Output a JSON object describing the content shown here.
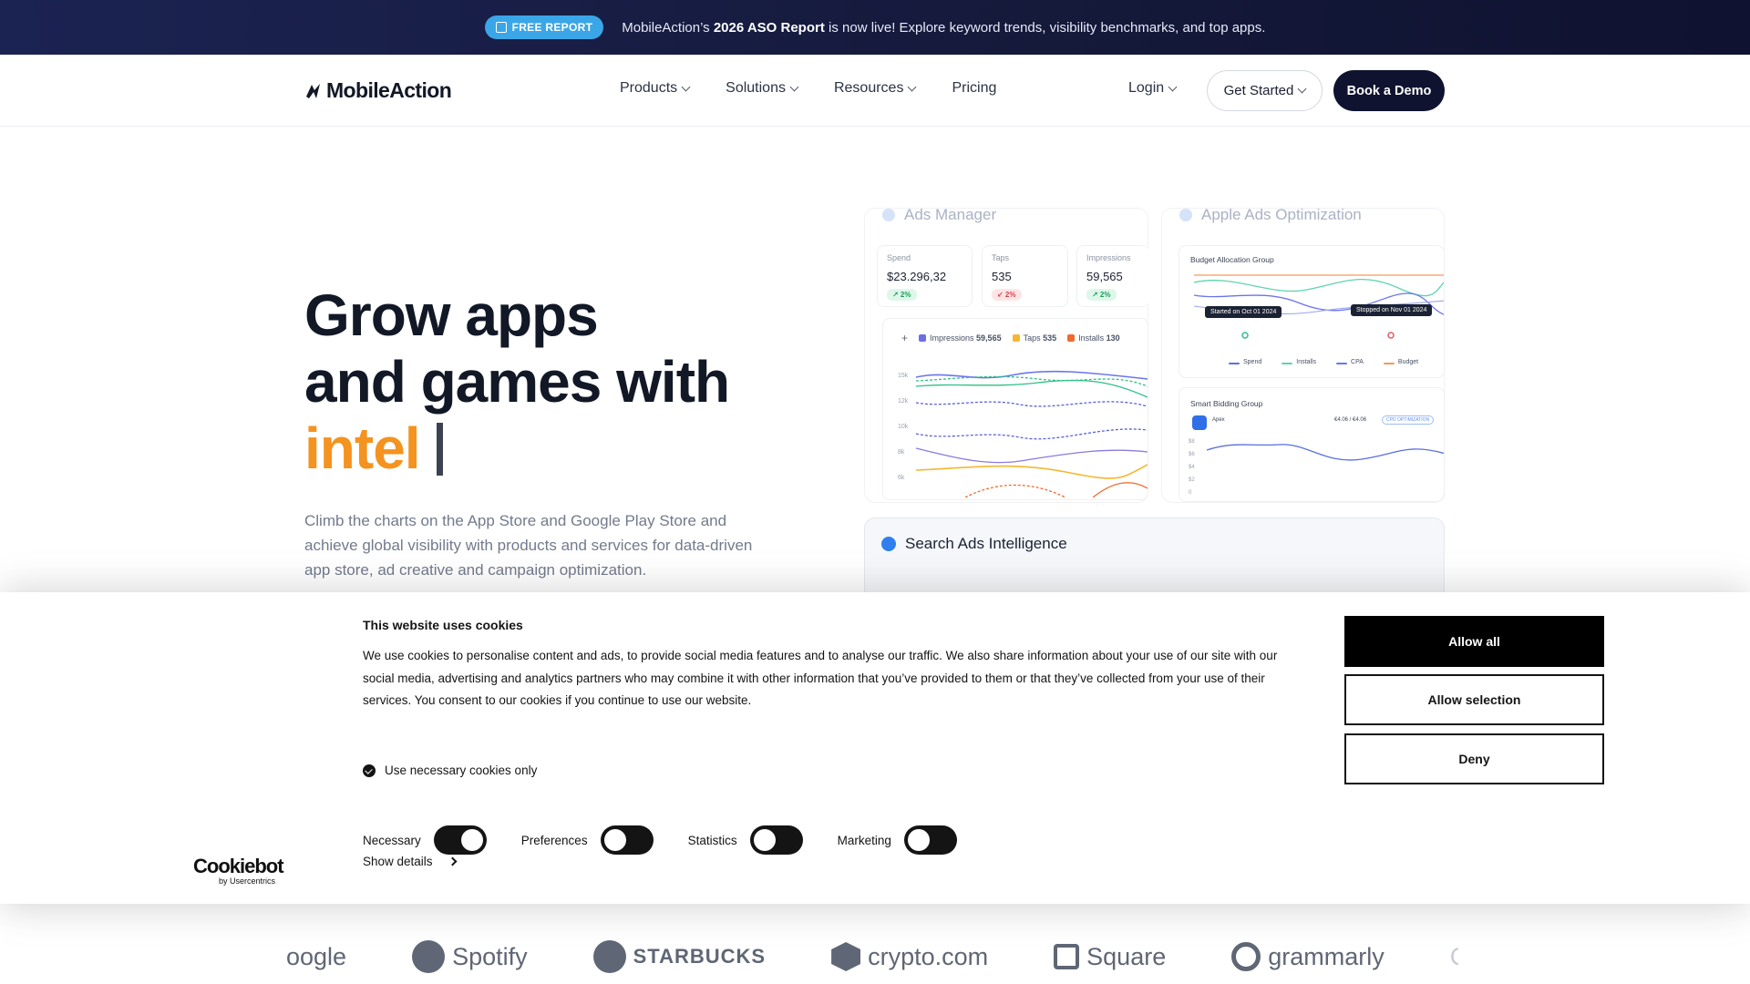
{
  "announcement": {
    "badge": "FREE REPORT",
    "text_prefix": "MobileAction’s ",
    "text_bold": "2026 ASO Report",
    "text_suffix": " is now live! Explore keyword trends, visibility benchmarks, and top apps."
  },
  "nav": {
    "logo": "MobileAction",
    "links": [
      "Products",
      "Solutions",
      "Resources",
      "Pricing"
    ],
    "login": "Login",
    "get_started": "Get Started",
    "book_demo": "Book a Demo"
  },
  "hero": {
    "title_line1": "Grow apps",
    "title_line2": "and games with",
    "title_accent": "intel",
    "description": "Climb the charts on the App Store and Google Play Store and achieve global visibility with products and services for data-driven app store, ad creative and campaign optimization."
  },
  "dashboard": {
    "ads_manager": {
      "title": "Ads Manager",
      "stats": [
        {
          "label": "Spend",
          "value": "$23.296,32",
          "change": "↗ 2%",
          "dir": "up"
        },
        {
          "label": "Taps",
          "value": "535",
          "change": "↙ 2%",
          "dir": "down"
        },
        {
          "label": "Impressions",
          "value": "59,565",
          "change": "↗ 2%",
          "dir": "up"
        }
      ],
      "legend": [
        {
          "name": "Impressions",
          "value": "59,565",
          "color": "#6b6ee8"
        },
        {
          "name": "Taps",
          "value": "535",
          "color": "#f5b731"
        },
        {
          "name": "Installs",
          "value": "130",
          "color": "#ee6a2f"
        }
      ],
      "y_ticks": [
        "15k",
        "12k",
        "10k",
        "8k",
        "6k"
      ]
    },
    "apple_ads": {
      "title": "Apple Ads Optimization",
      "budget_group": "Budget Allocation Group",
      "tooltip_start": "Started on Oct 01 2024",
      "tooltip_stop": "Stopped on Nov 01 2024",
      "legend": [
        {
          "name": "Spend",
          "color": "#5b6ee8"
        },
        {
          "name": "Installs",
          "color": "#5fd3b0"
        },
        {
          "name": "CPA",
          "color": "#6a74f0"
        },
        {
          "name": "Budget",
          "color": "#f29a5a"
        }
      ],
      "smart_group": "Smart Bidding Group",
      "app_name": "Apex",
      "bid": "€4.06 / €4.06",
      "tag": "CPD OPTIMIZATION",
      "y_ticks": [
        "$8",
        "$6",
        "$4",
        "$2",
        "0"
      ]
    },
    "search_ads": {
      "title": "Search Ads Intelligence"
    }
  },
  "cookie": {
    "title": "This website uses cookies",
    "body": "We use cookies to personalise content and ads, to provide social media features and to analyse our traffic. We also share information about your use of our site with our social media, advertising and analytics partners who may combine it with other information that you’ve provided to them or that they’ve collected from your use of their services. You consent to our cookies if you continue to use our website.",
    "check_label": "Use necessary cookies only",
    "toggles": [
      {
        "label": "Necessary",
        "state": "on"
      },
      {
        "label": "Preferences",
        "state": "off"
      },
      {
        "label": "Statistics",
        "state": "off"
      },
      {
        "label": "Marketing",
        "state": "off"
      }
    ],
    "details": "Show details",
    "btn_allow_all": "Allow all",
    "btn_allow_selection": "Allow selection",
    "btn_deny": "Deny",
    "brand": "Cookiebot",
    "brand_sub": "by Usercentrics"
  },
  "logos": [
    "oogle",
    "Spotify",
    "STARBUCKS",
    "crypto.com",
    "Square",
    "grammarly",
    "C"
  ]
}
